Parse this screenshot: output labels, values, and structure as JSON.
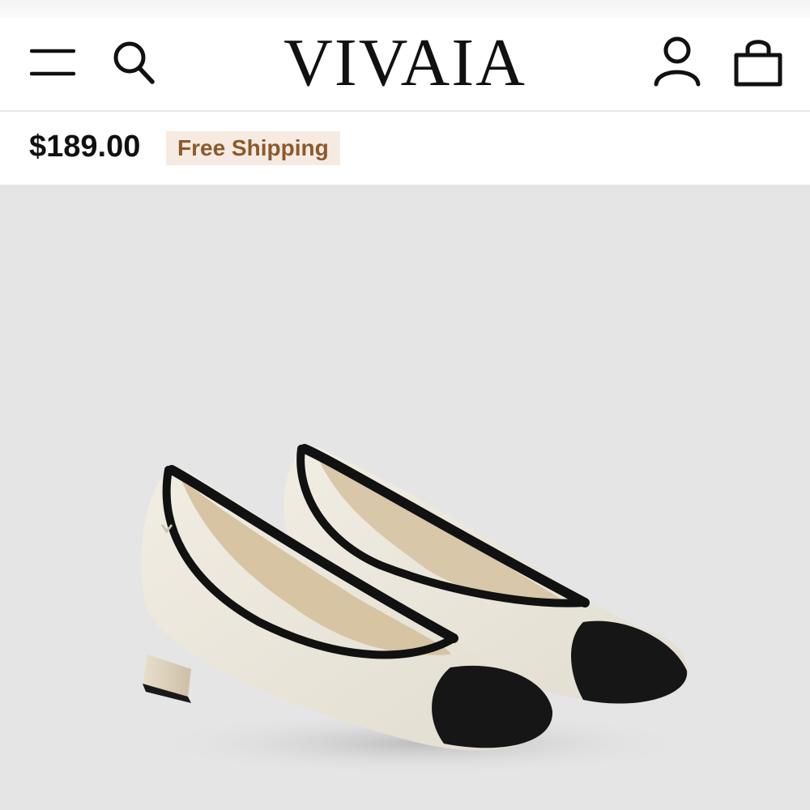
{
  "header": {
    "brand": "VIVAIA",
    "icons": {
      "menu": "hamburger-menu-icon",
      "search": "search-icon",
      "account": "user-account-icon",
      "bag": "shopping-bag-icon"
    }
  },
  "product": {
    "price": "$189.00",
    "shipping_badge": "Free Shipping"
  },
  "colors": {
    "badge_bg": "#f6ebe2",
    "badge_text": "#8b5a2b",
    "image_bg": "#e5e5e6"
  }
}
